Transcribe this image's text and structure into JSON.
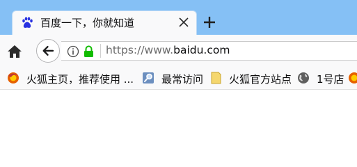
{
  "tab": {
    "title": "百度一下，你就知道",
    "favicon": "baidu-paw-icon",
    "close_icon": "close-icon"
  },
  "new_tab": {
    "icon": "plus-icon"
  },
  "navbar": {
    "home_icon": "home-icon",
    "back_icon": "back-arrow-icon",
    "info_icon": "info-icon",
    "lock_icon": "lock-icon",
    "url_scheme": "https://www.",
    "url_host": "baidu.com"
  },
  "bookmarks": [
    {
      "label": "火狐主页，推荐使用 ...",
      "icon": "firefox-icon"
    },
    {
      "label": "最常访问",
      "icon": "magnifier-icon"
    },
    {
      "label": "火狐官方站点",
      "icon": "folder-icon"
    },
    {
      "label": "1号店",
      "icon": "globe-icon"
    },
    {
      "label": "",
      "icon": "firefox-icon"
    }
  ],
  "colors": {
    "tabstrip_bg": "#85c0f5",
    "toolbar_bg": "#f9f9fa",
    "lock_green": "#12bc00",
    "baidu_blue": "#2932e1"
  }
}
